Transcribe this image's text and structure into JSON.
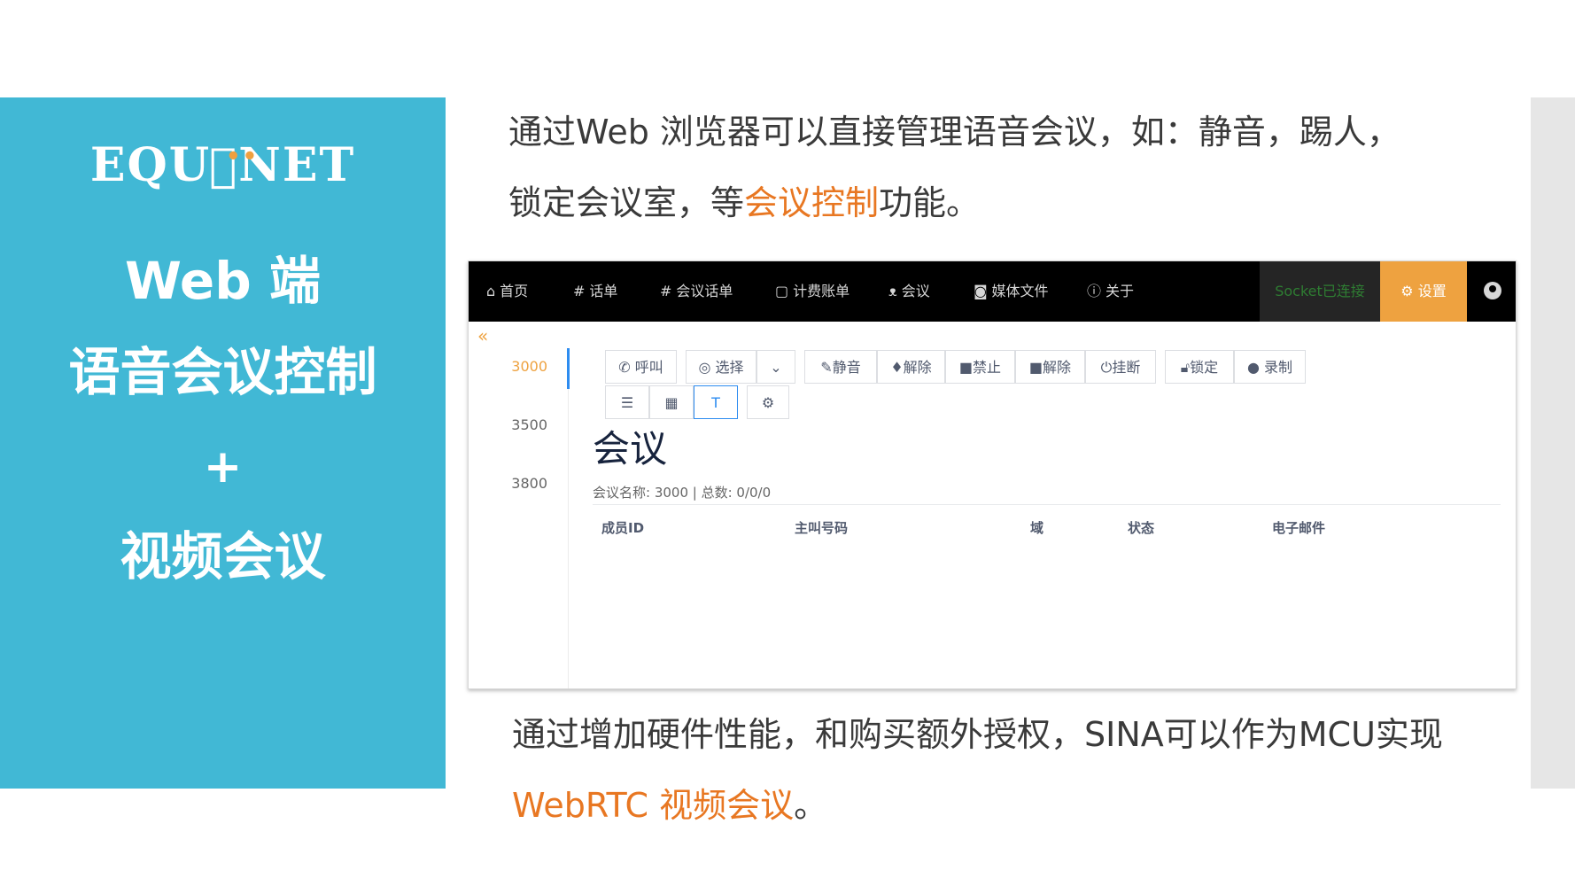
{
  "left_panel": {
    "logo": "EQU⃝NET",
    "line1": "Web 端",
    "line2": "语音会议控制",
    "line3": "+",
    "line4": "视频会议"
  },
  "captions": {
    "c1": "通过Web 浏览器可以直接管理语音会议，如：静音，踢人，",
    "c2_pre": "锁定会议室，等",
    "c2_highlight": "会议控制",
    "c2_post": "功能。",
    "c3": "通过增加硬件性能，和购买额外授权，SINA可以作为MCU实现",
    "c4_highlight": "WebRTC 视频会议",
    "c4_post": "。"
  },
  "navbar": {
    "items": [
      "首页",
      "话单",
      "会议话单",
      "计费账单",
      "会议",
      "媒体文件",
      "关于"
    ],
    "socket_status": "Socket已连接",
    "settings": "设置"
  },
  "sidebar": {
    "collapse_icon": "«",
    "conferences": [
      "3000",
      "3500",
      "3800"
    ],
    "active": "3000"
  },
  "toolbar": {
    "call": "呼叫",
    "select": "选择",
    "mute": "静音",
    "unmute": "解除",
    "video_off": "禁止",
    "video_on": "解除",
    "hangup": "挂断",
    "lock": "锁定",
    "record": "录制"
  },
  "conference": {
    "title": "会议",
    "info": "会议名称: 3000 | 总数: 0/0/0"
  },
  "table": {
    "headers": [
      "成员ID",
      "主叫号码",
      "域",
      "状态",
      "电子邮件"
    ]
  },
  "colors": {
    "panel": "#41b8d5",
    "accent_orange": "#e87722",
    "nav_active": "#eea240",
    "socket_green": "#2e7d32"
  }
}
